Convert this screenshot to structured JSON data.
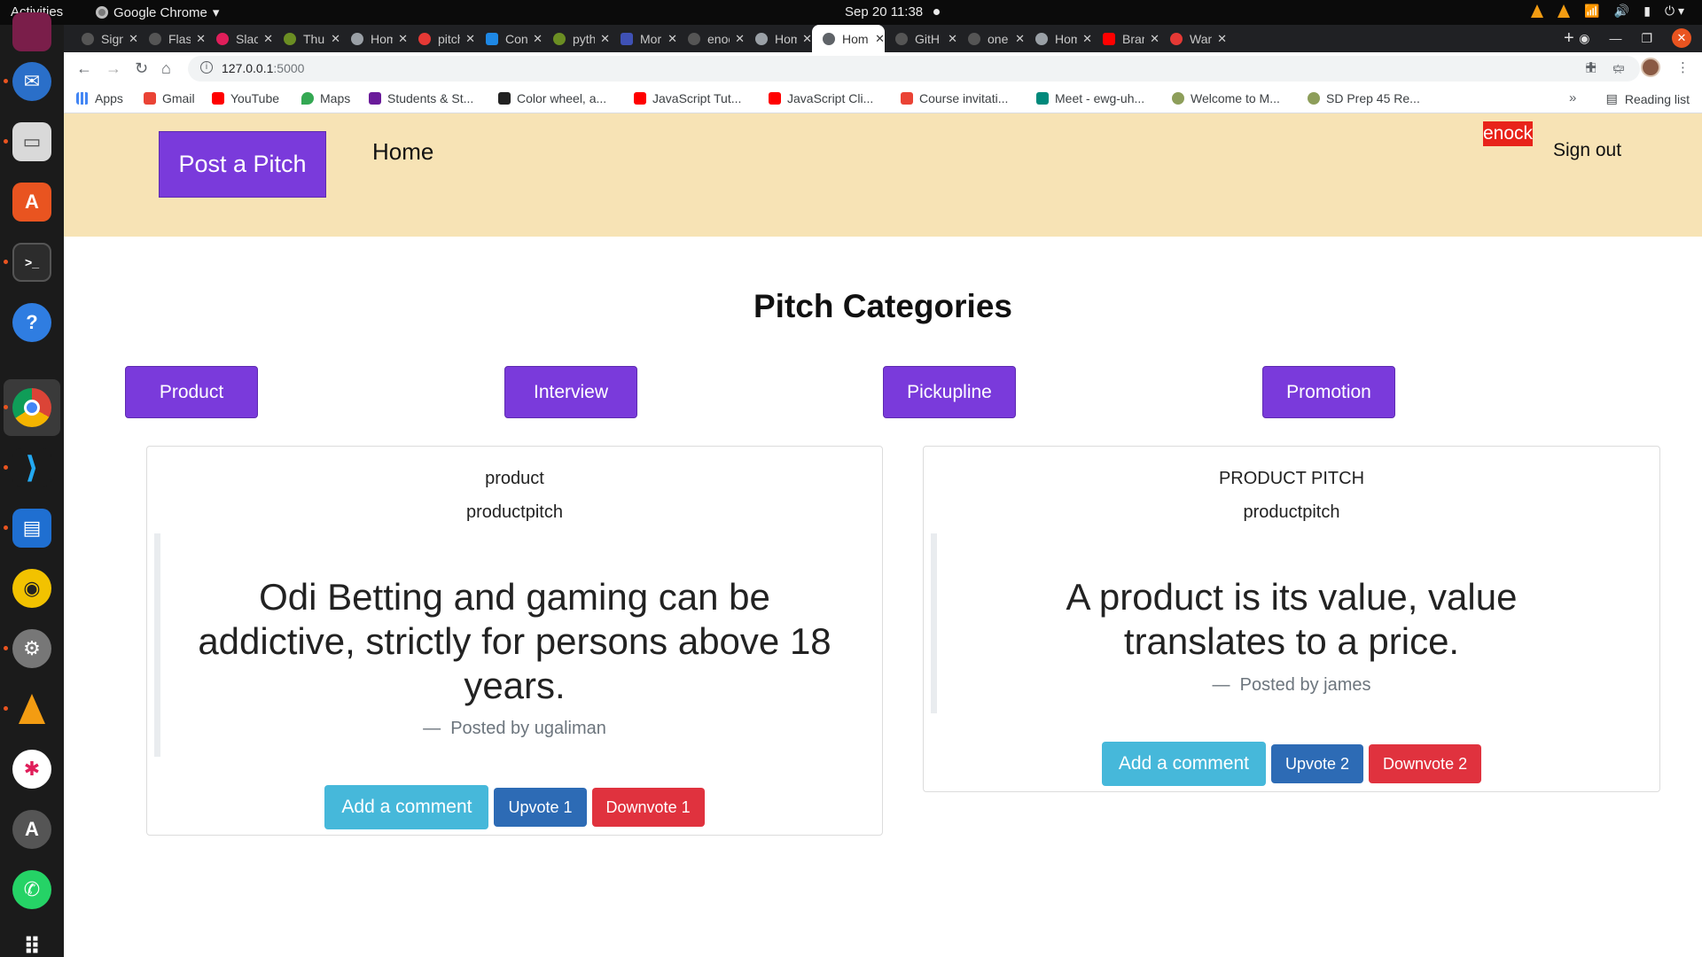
{
  "system": {
    "activities": "Activities",
    "app_name": "Google Chrome",
    "clock": "Sep 20  11:38"
  },
  "browser": {
    "tabs": [
      {
        "label": "Sign",
        "favicon": "github-icon",
        "color": "#555555"
      },
      {
        "label": "Flask",
        "favicon": "github-icon",
        "color": "#555555"
      },
      {
        "label": "Slack",
        "favicon": "slack-icon",
        "color": "#e01e5a"
      },
      {
        "label": "Thu",
        "favicon": "plant-icon",
        "color": "#6b8e23"
      },
      {
        "label": "Hom",
        "favicon": "globe-icon",
        "color": "#9aa0a6"
      },
      {
        "label": "pitch",
        "favicon": "pitch-icon",
        "color": "#e53935"
      },
      {
        "label": "Con",
        "favicon": "h-icon",
        "color": "#1e88e5"
      },
      {
        "label": "pyth",
        "favicon": "plant-icon",
        "color": "#6b8e23"
      },
      {
        "label": "Mor",
        "favicon": "calendar-icon",
        "color": "#3f51b5"
      },
      {
        "label": "enoc",
        "favicon": "github-icon",
        "color": "#555555"
      },
      {
        "label": "Hom",
        "favicon": "globe-icon",
        "color": "#9aa0a6"
      },
      {
        "label": "Hom",
        "favicon": "globe-icon",
        "color": "#5f6368"
      },
      {
        "label": "GitH",
        "favicon": "github-icon",
        "color": "#555555"
      },
      {
        "label": "one",
        "favicon": "github-icon",
        "color": "#555555"
      },
      {
        "label": "Hom",
        "favicon": "globe-icon",
        "color": "#9aa0a6"
      },
      {
        "label": "Bran",
        "favicon": "youtube-icon",
        "color": "#ff0000"
      },
      {
        "label": "Wan",
        "favicon": "asterisk-icon",
        "color": "#e53935"
      }
    ],
    "active_tab_index": 11,
    "url_host": "127.0.0.1",
    "url_port": ":5000",
    "bookmarks": [
      {
        "label": "Apps",
        "favicon": "apps-icon",
        "color": "#4285f4"
      },
      {
        "label": "Gmail",
        "favicon": "gmail-icon",
        "color": "#ea4335"
      },
      {
        "label": "YouTube",
        "favicon": "youtube-icon",
        "color": "#ff0000"
      },
      {
        "label": "Maps",
        "favicon": "maps-pin-icon",
        "color": "#34a853"
      },
      {
        "label": "Students & St...",
        "favicon": "list-icon",
        "color": "#6a1b9a"
      },
      {
        "label": "Color wheel, a...",
        "favicon": "color-wheel-icon",
        "color": "#222222"
      },
      {
        "label": "JavaScript Tut...",
        "favicon": "youtube-icon",
        "color": "#ff0000"
      },
      {
        "label": "JavaScript Cli...",
        "favicon": "youtube-icon",
        "color": "#ff0000"
      },
      {
        "label": "Course invitati...",
        "favicon": "gmail-icon",
        "color": "#ea4335"
      },
      {
        "label": "Meet - ewg-uh...",
        "favicon": "meet-icon",
        "color": "#00897b"
      },
      {
        "label": "Welcome to M...",
        "favicon": "plant-icon",
        "color": "#8d9e5a"
      },
      {
        "label": "SD Prep 45 Re...",
        "favicon": "plant-icon",
        "color": "#8d9e5a"
      }
    ],
    "bookmarks_more": "»",
    "reading_list": "Reading list"
  },
  "page": {
    "nav": {
      "post_pitch": "Post a Pitch",
      "home": "Home",
      "username": "enock",
      "sign_out": "Sign out"
    },
    "categories_heading": "Pitch Categories",
    "categories": [
      "Product",
      "Interview",
      "Pickupline",
      "Promotion"
    ],
    "pitches": [
      {
        "title": "product",
        "category": "productpitch",
        "text": "Odi Betting and gaming can be addictive, strictly for persons above 18 years.",
        "author": "Posted by ugaliman",
        "comment_label": "Add a comment",
        "upvote_label": "Upvote 1",
        "downvote_label": "Downvote 1"
      },
      {
        "title": "PRODUCT PITCH",
        "category": "productpitch",
        "text": "A product is its value, value translates to a price.",
        "author": "Posted by james",
        "comment_label": "Add a comment",
        "upvote_label": "Upvote 2",
        "downvote_label": "Downvote 2"
      }
    ]
  },
  "colors": {
    "navbar_bg": "#f7e3b5",
    "primary_purple": "#7a3adb",
    "username_badge": "#e8231a",
    "comment_btn": "#46b8da",
    "upvote_btn": "#2d6bb5",
    "downvote_btn": "#e0323e"
  }
}
